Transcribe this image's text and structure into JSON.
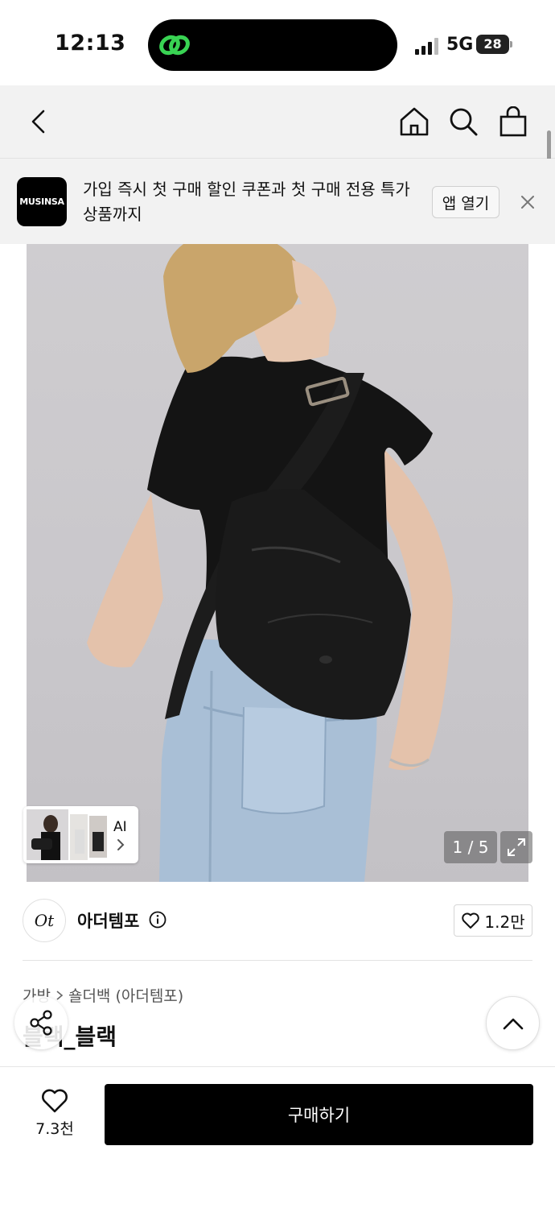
{
  "status_bar": {
    "time": "12:13",
    "network": "5G",
    "battery": "28"
  },
  "nav": {
    "icons": [
      "back-icon",
      "home-icon",
      "search-icon",
      "shopping-bag-icon"
    ]
  },
  "banner": {
    "logo_text": "MUSINSA",
    "message": "가입 즉시 첫 구매 할인 쿠폰과 첫 구매 전용 특가 상품까지",
    "open_app_label": "앱 열기"
  },
  "gallery": {
    "ai_label": "AI",
    "page_counter": "1 / 5"
  },
  "brand": {
    "logo_text": "Ot",
    "name": "아더템포",
    "like_count": "1.2만"
  },
  "product": {
    "breadcrumb": [
      "가방",
      "숄더백 (아더템포)"
    ],
    "title": "블랙_블랙"
  },
  "bottom_bar": {
    "wish_count": "7.3천",
    "buy_label": "구매하기"
  },
  "colors": {
    "accent": "#000000",
    "background": "#ffffff",
    "nav_background": "#f2f2f2"
  }
}
